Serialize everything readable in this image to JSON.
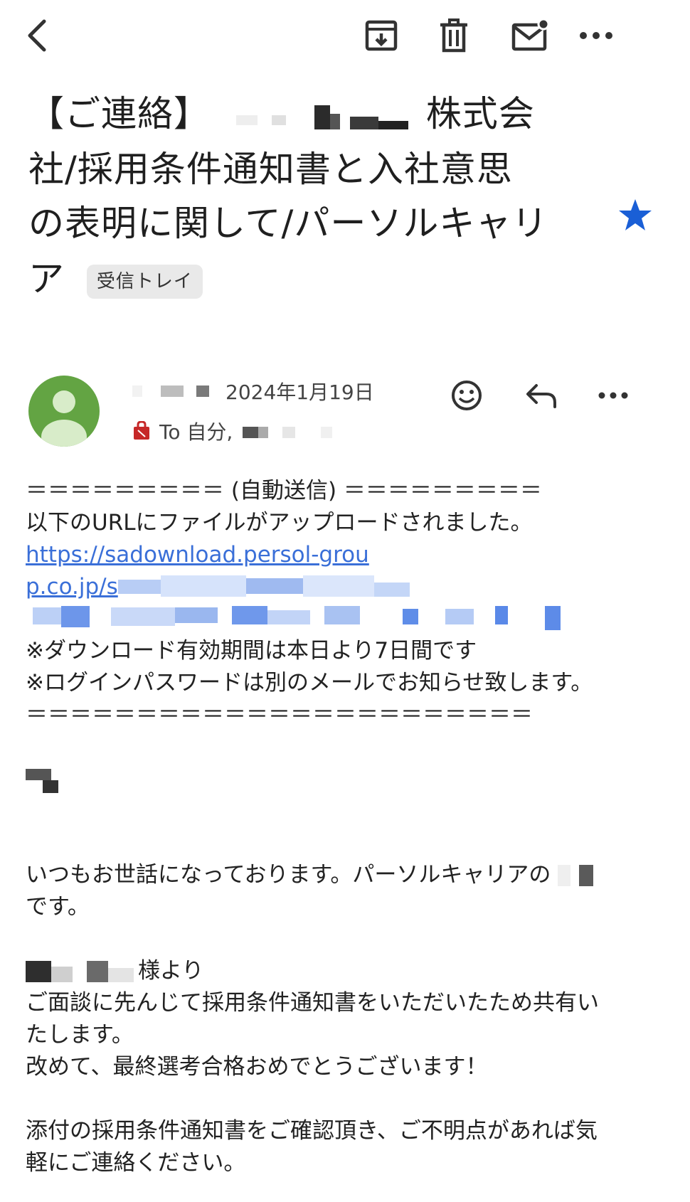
{
  "toolbar": {
    "back_icon": "chevron-left-icon",
    "archive_icon": "archive-icon",
    "delete_icon": "trash-icon",
    "unread_icon": "mail-unread-icon",
    "more_icon": "more-horizontal-icon"
  },
  "subject": {
    "line1_prefix": "【ご連絡】",
    "line1_suffix": "株式会",
    "line2": "社/採用条件通知書と入社意思",
    "line3": "の表明に関して/パーソルキャリ",
    "line4": "ア",
    "label": "受信トレイ",
    "starred": true
  },
  "message": {
    "date": "2024年1月19日",
    "to_label": "To 自分,",
    "body": {
      "l1": "＝＝＝＝＝＝＝＝＝ (自動送信) ＝＝＝＝＝＝＝＝＝",
      "l2": "以下のURLにファイルがアップロードされました。",
      "link1": "https://sadownload.persol-grou",
      "link2": "p.co.jp/s",
      "l4": "※ダウンロード有効期間は本日より7日間です",
      "l5": "※ログインパスワードは別のメールでお知らせ致します。",
      "l6": "＝＝＝＝＝＝＝＝＝＝＝＝＝＝＝＝＝＝＝＝＝＝＝",
      "l7": "いつもお世話になっております。パーソルキャリアの",
      "l8": "です。",
      "l9_suffix": "様より",
      "l10": "ご面談に先んじて採用条件通知書をいただいたため共有い",
      "l11": "たします。",
      "l12": "改めて、最終選考合格おめでとうございます！",
      "l13": "添付の採用条件通知書をご確認頂き、ご不明点があれば気",
      "l14": "軽にご連絡ください。"
    }
  },
  "colors": {
    "avatar": "#63a443",
    "star": "#1a5fd6",
    "link": "#3a6fd8",
    "label_bg": "#e9e9e9",
    "external_badge": "#c62828"
  }
}
